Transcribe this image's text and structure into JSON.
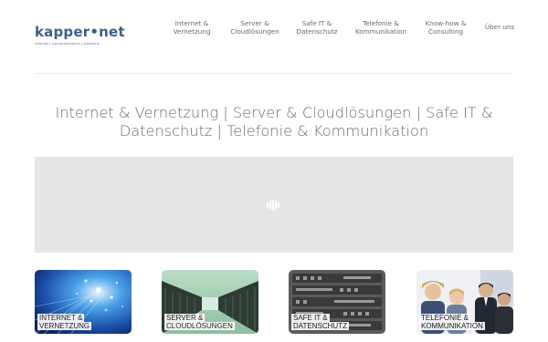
{
  "logo": {
    "name": "kapper",
    "dot": "•",
    "suffix": "net",
    "tagline": "internet | communications | solutions"
  },
  "nav": [
    {
      "label": "Internet &\nVernetzung"
    },
    {
      "label": "Server &\nCloudlösungen"
    },
    {
      "label": "Safe IT &\nDatenschutz"
    },
    {
      "label": "Telefonie &\nKommunikation"
    },
    {
      "label": "Know-how &\nConsulting"
    },
    {
      "label": "Über uns"
    }
  ],
  "headline": "Internet & Vernetzung | Server & Cloudlösungen | Safe IT & Datenschutz | Telefonie & Kommunikation",
  "tiles": [
    {
      "label": "Internet &\nVernetzung",
      "image": "fiber-optic-cables"
    },
    {
      "label": "Server &\nCloudlösungen",
      "image": "server-room-aisle"
    },
    {
      "label": "Safe IT &\nDatenschutz",
      "image": "server-rack-hardware"
    },
    {
      "label": "Telefonie &\nKommunikation",
      "image": "office-team-people"
    }
  ]
}
